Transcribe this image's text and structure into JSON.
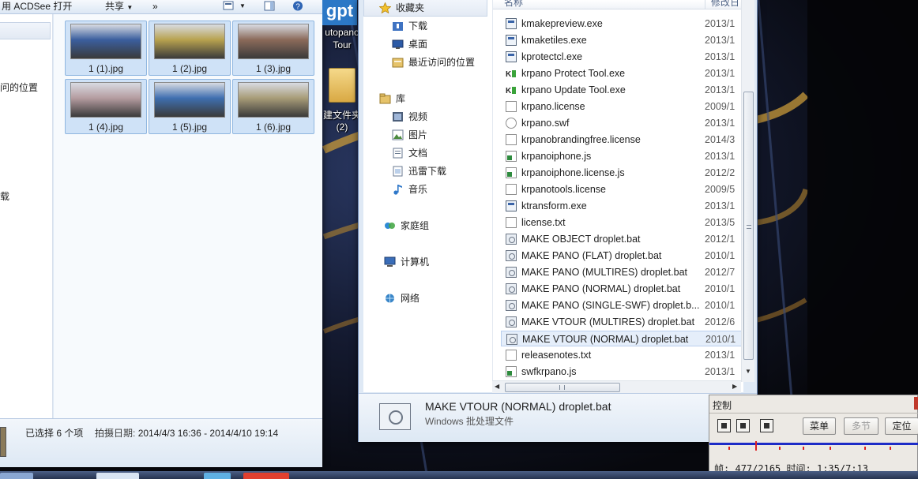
{
  "left_window": {
    "toolbar": {
      "open_with": "用 ACDSee 打开",
      "share": "共享",
      "more": "»"
    },
    "nav_fragments": {
      "recent": "问的位置",
      "download": "载"
    },
    "thumbnails": [
      {
        "label": "1 (1).jpg",
        "tone": "#3b5f9e"
      },
      {
        "label": "1 (2).jpg",
        "tone": "#b8a24f"
      },
      {
        "label": "1 (3).jpg",
        "tone": "#8b6a5a"
      },
      {
        "label": "1 (4).jpg",
        "tone": "#b59ca0"
      },
      {
        "label": "1 (5).jpg",
        "tone": "#3f6fb0"
      },
      {
        "label": "1 (6).jpg",
        "tone": "#a89c78"
      }
    ],
    "details": {
      "selected": "已选择 6 个项",
      "shoot_label": "拍摄日期:",
      "shoot_range": "2014/4/3 16:36 - 2014/4/10 19:14"
    }
  },
  "desktop_icon": {
    "logo": "gpt",
    "label_line1": "utopano",
    "label_line2": "Tour",
    "folder_line1": "建文件夹",
    "folder_line2": "(2)"
  },
  "right_window": {
    "nav": {
      "favorites": "收藏夹",
      "downloads": "下载",
      "desktop": "桌面",
      "recent": "最近访问的位置",
      "libraries": "库",
      "videos": "视频",
      "pictures": "图片",
      "documents": "文档",
      "thunder": "迅雷下载",
      "music": "音乐",
      "homegroup": "家庭组",
      "computer": "计算机",
      "network": "网络"
    },
    "columns": {
      "name": "名称",
      "modified": "修改日"
    },
    "files": [
      {
        "name": "kmakepreview.exe",
        "date": "2013/1",
        "icon": "exe"
      },
      {
        "name": "kmaketiles.exe",
        "date": "2013/1",
        "icon": "exe"
      },
      {
        "name": "kprotectcl.exe",
        "date": "2013/1",
        "icon": "exe"
      },
      {
        "name": "krpano Protect Tool.exe",
        "date": "2013/1",
        "icon": "krp"
      },
      {
        "name": "krpano Update Tool.exe",
        "date": "2013/1",
        "icon": "krp"
      },
      {
        "name": "krpano.license",
        "date": "2009/1",
        "icon": "doc"
      },
      {
        "name": "krpano.swf",
        "date": "2013/1",
        "icon": "swf"
      },
      {
        "name": "krpanobrandingfree.license",
        "date": "2014/3",
        "icon": "doc"
      },
      {
        "name": "krpanoiphone.js",
        "date": "2013/1",
        "icon": "js"
      },
      {
        "name": "krpanoiphone.license.js",
        "date": "2012/2",
        "icon": "js"
      },
      {
        "name": "krpanotools.license",
        "date": "2009/5",
        "icon": "doc"
      },
      {
        "name": "ktransform.exe",
        "date": "2013/1",
        "icon": "exe"
      },
      {
        "name": "license.txt",
        "date": "2013/5",
        "icon": "doc"
      },
      {
        "name": "MAKE OBJECT droplet.bat",
        "date": "2012/1",
        "icon": "bat"
      },
      {
        "name": "MAKE PANO (FLAT) droplet.bat",
        "date": "2010/1",
        "icon": "bat"
      },
      {
        "name": "MAKE PANO (MULTIRES) droplet.bat",
        "date": "2012/7",
        "icon": "bat"
      },
      {
        "name": "MAKE PANO (NORMAL) droplet.bat",
        "date": "2010/1",
        "icon": "bat"
      },
      {
        "name": "MAKE PANO (SINGLE-SWF) droplet.b...",
        "date": "2010/1",
        "icon": "bat"
      },
      {
        "name": "MAKE VTOUR (MULTIRES) droplet.bat",
        "date": "2012/6",
        "icon": "bat"
      },
      {
        "name": "MAKE VTOUR (NORMAL) droplet.bat",
        "date": "2010/1",
        "icon": "bat",
        "selected": true
      },
      {
        "name": "releasenotes.txt",
        "date": "2013/1",
        "icon": "doc"
      },
      {
        "name": "swfkrpano.js",
        "date": "2013/1",
        "icon": "js"
      }
    ],
    "details": {
      "name": "MAKE VTOUR (NORMAL) droplet.bat",
      "type": "Windows 批处理文件"
    }
  },
  "control_panel": {
    "title": "控制",
    "menu": "菜单",
    "chapter": "多节",
    "locate": "定位",
    "frame_label": "帧:",
    "frame_value": "477/2165",
    "time_label": "时间:",
    "time_value": "1:35/7:13",
    "progress_fraction": 0.22
  }
}
